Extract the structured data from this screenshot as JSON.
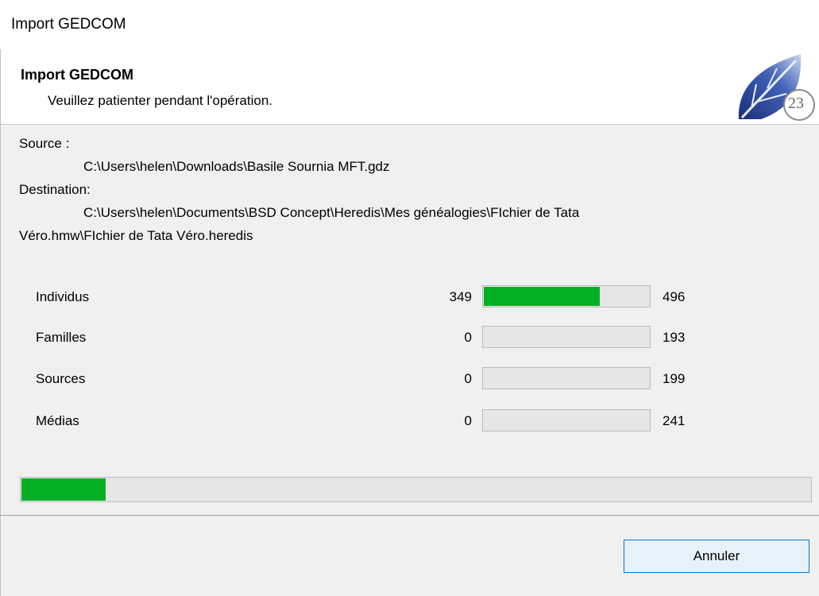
{
  "window": {
    "title": "Import GEDCOM"
  },
  "header": {
    "title": "Import GEDCOM",
    "subtitle": "Veuillez patienter pendant l'opération.",
    "logo_icon": "heredis-leaf-logo-icon",
    "logo_text": "23"
  },
  "source": {
    "label": "Source :",
    "path": "C:\\Users\\helen\\Downloads\\Basile Sournia MFT.gdz"
  },
  "destination": {
    "label": "Destination:",
    "path_line1": "C:\\Users\\helen\\Documents\\BSD Concept\\Heredis\\Mes généalogies\\FIchier de Tata",
    "path_line2": "Véro.hmw\\FIchier de Tata Véro.heredis"
  },
  "counters": [
    {
      "label": "Individus",
      "current": "349",
      "total": "496",
      "progress": 0.7
    },
    {
      "label": "Familles",
      "current": "0",
      "total": "193",
      "progress": 0
    },
    {
      "label": "Sources",
      "current": "0",
      "total": "199",
      "progress": 0
    },
    {
      "label": "Médias",
      "current": "0",
      "total": "241",
      "progress": 0
    }
  ],
  "overall_progress": 0.107,
  "buttons": {
    "cancel_label": "Annuler"
  },
  "colors": {
    "progress_fill": "#06b025",
    "button_border": "#0078d7",
    "button_bg": "#e5f1fb"
  }
}
